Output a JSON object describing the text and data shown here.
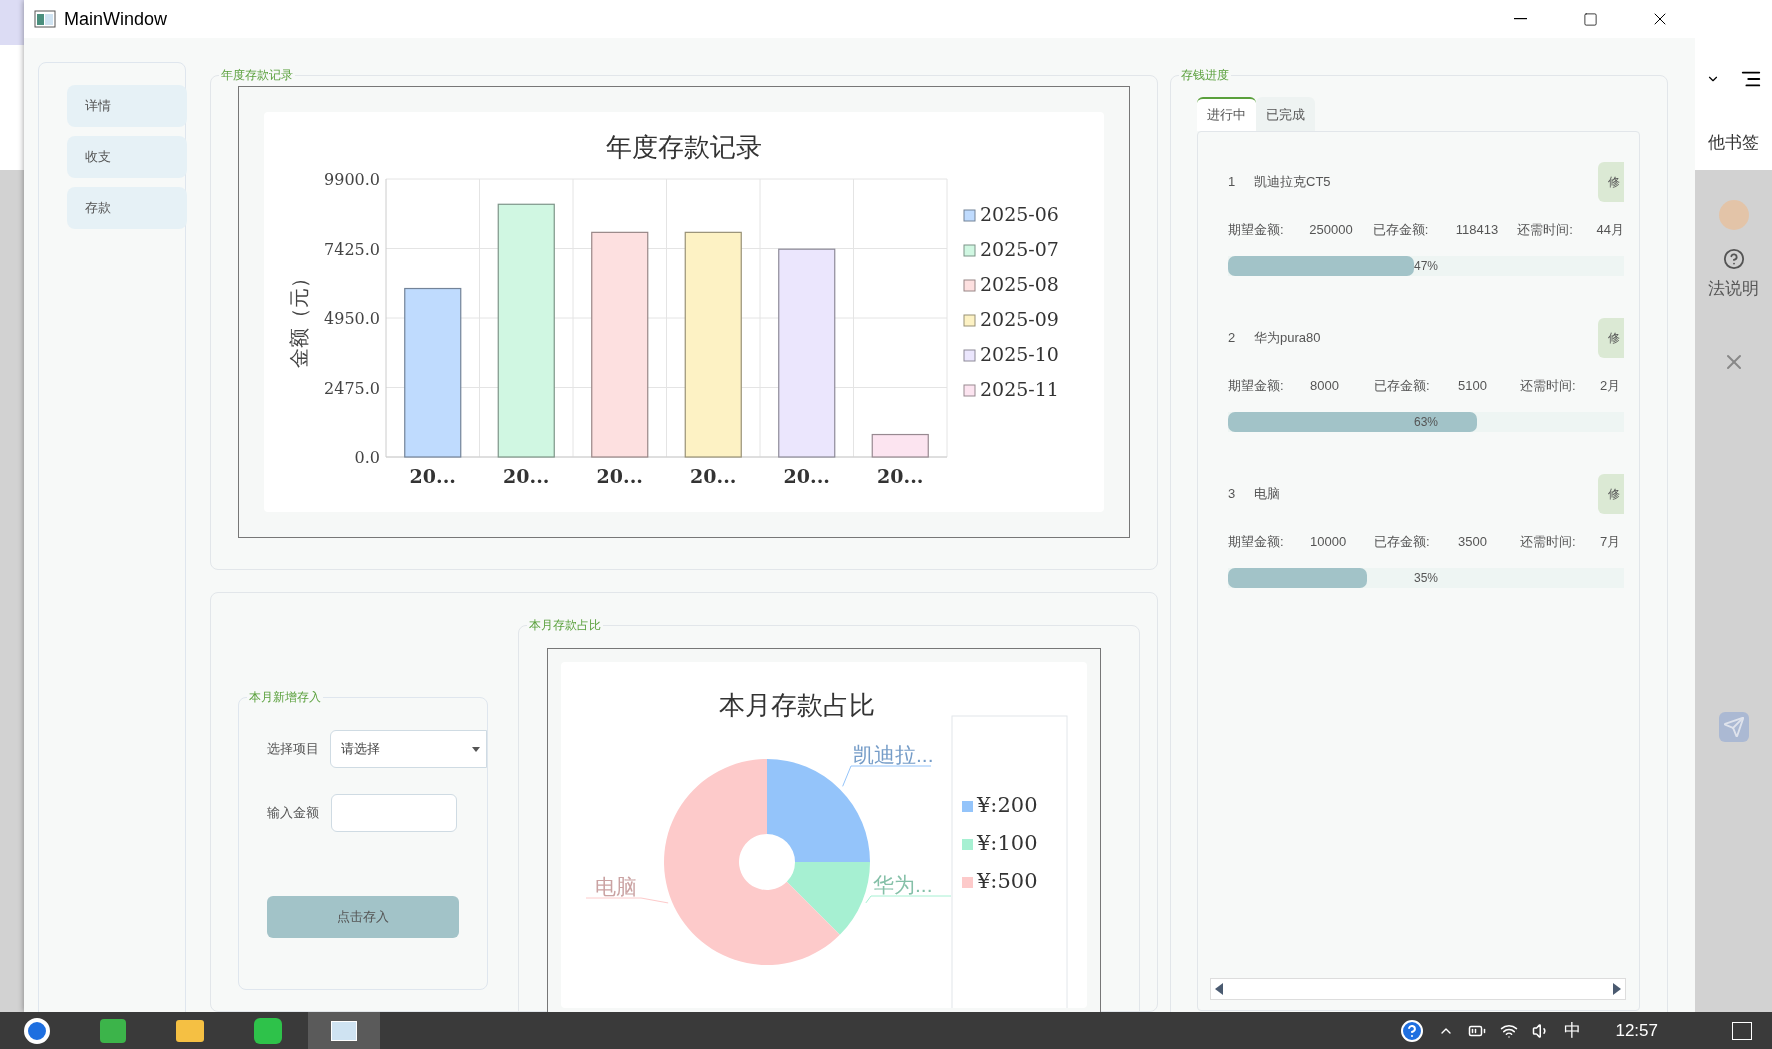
{
  "window": {
    "title": "MainWindow"
  },
  "sidebar": {
    "items": [
      {
        "label": "详情",
        "selected": false
      },
      {
        "label": "收支",
        "selected": false
      },
      {
        "label": "存款",
        "selected": false
      }
    ]
  },
  "annual": {
    "group_title": "年度存款记录",
    "chart_data": {
      "type": "bar",
      "title": "年度存款记录",
      "ylabel": "金额（元）",
      "categories": [
        "20...",
        "20...",
        "20...",
        "20...",
        "20...",
        "20..."
      ],
      "ylim": [
        0,
        9900
      ],
      "grid": true,
      "legend": true,
      "yticks": [
        {
          "value": 0,
          "label": "0.0"
        },
        {
          "value": 2475,
          "label": "2475.0"
        },
        {
          "value": 4950,
          "label": "4950.0"
        },
        {
          "value": 7425,
          "label": "7425.0"
        },
        {
          "value": 9900,
          "label": "9900.0"
        }
      ],
      "series": [
        {
          "name": "2025-06",
          "color": "#bfdbfe",
          "values": [
            6000,
            null,
            null,
            null,
            null,
            null
          ]
        },
        {
          "name": "2025-07",
          "color": "#d0f7e2",
          "values": [
            null,
            9000,
            null,
            null,
            null,
            null
          ]
        },
        {
          "name": "2025-08",
          "color": "#fde0e0",
          "values": [
            null,
            null,
            8000,
            null,
            null,
            null
          ]
        },
        {
          "name": "2025-09",
          "color": "#fdf2c4",
          "values": [
            null,
            null,
            null,
            8000,
            null,
            null
          ]
        },
        {
          "name": "2025-10",
          "color": "#ebe6fd",
          "values": [
            null,
            null,
            null,
            null,
            7400,
            null
          ]
        },
        {
          "name": "2025-11",
          "color": "#fce4f0",
          "values": [
            null,
            null,
            null,
            null,
            null,
            800
          ]
        }
      ]
    }
  },
  "deposit_form": {
    "group_title": "本月新增存入",
    "project_label": "选择项目",
    "project_select": {
      "value": "请选择"
    },
    "amount_label": "输入金额",
    "submit_button": "点击存入"
  },
  "monthly": {
    "group_title": "本月存款占比",
    "chart_data": {
      "type": "donut",
      "title": "本月存款占比",
      "categories": [
        "凯迪拉...",
        "华为...",
        "电脑"
      ],
      "values": [
        25,
        12.5,
        62.5
      ],
      "colors": [
        "#94c4fa",
        "#a6f0d2",
        "#fdcaca"
      ]
    },
    "legend": [
      "¥:200",
      "¥:100",
      "¥:500"
    ]
  },
  "progress": {
    "group_title": "存钱进度",
    "tabs": [
      {
        "label": "进行中",
        "selected": true
      },
      {
        "label": "已完成",
        "selected": false
      }
    ],
    "items": [
      {
        "index": "1",
        "name": "凯迪拉克CT5",
        "edit_button": "修",
        "expected_label": "期望金额:",
        "expected": "250000",
        "saved_label": "已存金额:",
        "saved": "118413",
        "remaining_label": "还需时间:",
        "remaining": "44月",
        "level": 0.47,
        "percent": "47%"
      },
      {
        "index": "2",
        "name": "华为pura80",
        "edit_button": "修",
        "expected_label": "期望金额:",
        "expected": "8000",
        "saved_label": "已存金额:",
        "saved": "5100",
        "remaining_label": "还需时间:",
        "remaining": "2月",
        "level": 0.63,
        "percent": "63%"
      },
      {
        "index": "3",
        "name": "电脑",
        "edit_button": "修",
        "expected_label": "期望金额:",
        "expected": "10000",
        "saved_label": "已存金额:",
        "saved": "3500",
        "remaining_label": "还需时间:",
        "remaining": "7月",
        "level": 0.35,
        "percent": "35%"
      }
    ]
  },
  "background": {
    "fragments": [
      "他书签",
      "法说明"
    ]
  },
  "taskbar": {
    "ime": "中",
    "clock": "12:57"
  }
}
